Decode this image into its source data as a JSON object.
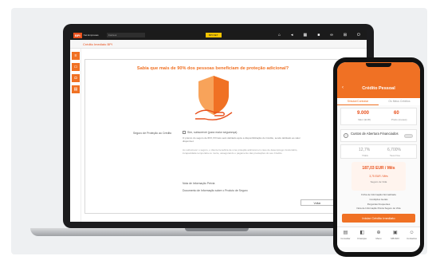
{
  "laptop": {
    "logo": {
      "mark": "BPI",
      "text": "Net Empresas"
    },
    "top_field": "Conta à",
    "top_badge": "BPI NET",
    "top_icons": [
      "home-icon",
      "megaphone-icon",
      "grid-icon",
      "lock-icon",
      "link-icon",
      "cart-icon",
      "power-icon"
    ],
    "breadcrumb": "Crédito Imediato BPI",
    "sidebar_icons": [
      "menu-icon",
      "folder-icon",
      "chat-icon",
      "document-icon"
    ],
    "headline": "Sabia que mais de 90% dos pessoas beneficiam de proteção adicional?",
    "insurance_label": "Seguro de Proteção ao Crédito",
    "checkbox_label": "Sim, subscrever (para maior segurança)",
    "desc_1": "O prémio do seguro de €XX,XX/mês será debitado após a disponibilização do Crédito, sendo debitado ao valor disponível.",
    "desc_2": "Ao subscrever o seguro, o cliente beneficia de uma proteção adicional em caso de desemprego involuntário, incapacidade temporária ou morte, assegurando o pagamento das prestações do seu Crédito.",
    "link_1": "Nota de Informação Prévia",
    "link_2": "Documento de Informação sobre o Produto de Seguro",
    "back_button": "Voltar"
  },
  "phone": {
    "title": "Crédito Pessoal",
    "tabs": [
      "Simular/Contratar",
      "Os Meus Créditos"
    ],
    "amount": {
      "value": "9.000",
      "label": "Valor (EUR)"
    },
    "term": {
      "value": "60",
      "label": "Prazo (meses)"
    },
    "costs_title": "Custos de Abertura Financiados",
    "taeg": {
      "value": "12,7%",
      "label": "TAEG"
    },
    "tan": {
      "value": "6,700%",
      "label": "Taxa Fixa"
    },
    "monthly_value": "187,03 EUR / Mês",
    "monthly_sub": "3,75 EUR / Mês",
    "monthly_label": "Seguro de Vida",
    "doc_links": [
      "Ficha de Informação Normalizada",
      "Condições Gerais",
      "Perguntas Frequentes",
      "Nota de Informação Prévia Seguro de Vida"
    ],
    "cta": "Iniciar Crédito Imediato",
    "nav": [
      {
        "label": "Consultar",
        "icon": "document-icon"
      },
      {
        "label": "Finanças",
        "icon": "wallet-icon"
      },
      {
        "label": "Menu",
        "icon": "plus-circle-icon"
      },
      {
        "label": "MB WAY",
        "icon": "mbway-icon"
      },
      {
        "label": "Contactos",
        "icon": "people-icon"
      }
    ]
  },
  "colors": {
    "accent": "#f07124",
    "accent_dark": "#e8501c",
    "topbar": "#1b1b1b",
    "device": "#1c1c1e"
  }
}
